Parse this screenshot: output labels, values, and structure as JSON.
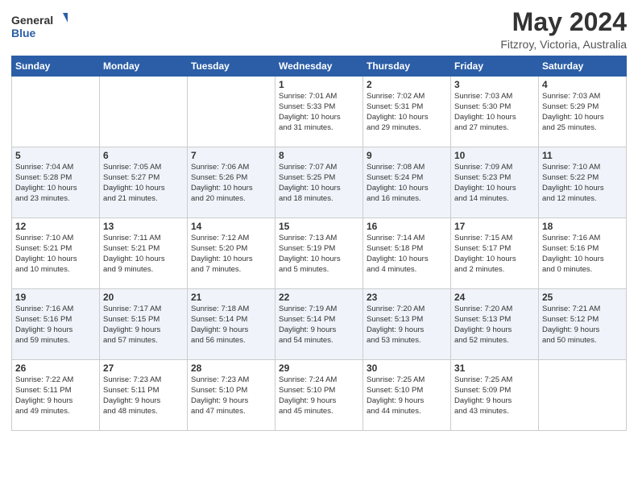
{
  "header": {
    "logo_line1": "General",
    "logo_line2": "Blue",
    "month_title": "May 2024",
    "location": "Fitzroy, Victoria, Australia"
  },
  "weekdays": [
    "Sunday",
    "Monday",
    "Tuesday",
    "Wednesday",
    "Thursday",
    "Friday",
    "Saturday"
  ],
  "weeks": [
    [
      {
        "day": "",
        "info": ""
      },
      {
        "day": "",
        "info": ""
      },
      {
        "day": "",
        "info": ""
      },
      {
        "day": "1",
        "info": "Sunrise: 7:01 AM\nSunset: 5:33 PM\nDaylight: 10 hours\nand 31 minutes."
      },
      {
        "day": "2",
        "info": "Sunrise: 7:02 AM\nSunset: 5:31 PM\nDaylight: 10 hours\nand 29 minutes."
      },
      {
        "day": "3",
        "info": "Sunrise: 7:03 AM\nSunset: 5:30 PM\nDaylight: 10 hours\nand 27 minutes."
      },
      {
        "day": "4",
        "info": "Sunrise: 7:03 AM\nSunset: 5:29 PM\nDaylight: 10 hours\nand 25 minutes."
      }
    ],
    [
      {
        "day": "5",
        "info": "Sunrise: 7:04 AM\nSunset: 5:28 PM\nDaylight: 10 hours\nand 23 minutes."
      },
      {
        "day": "6",
        "info": "Sunrise: 7:05 AM\nSunset: 5:27 PM\nDaylight: 10 hours\nand 21 minutes."
      },
      {
        "day": "7",
        "info": "Sunrise: 7:06 AM\nSunset: 5:26 PM\nDaylight: 10 hours\nand 20 minutes."
      },
      {
        "day": "8",
        "info": "Sunrise: 7:07 AM\nSunset: 5:25 PM\nDaylight: 10 hours\nand 18 minutes."
      },
      {
        "day": "9",
        "info": "Sunrise: 7:08 AM\nSunset: 5:24 PM\nDaylight: 10 hours\nand 16 minutes."
      },
      {
        "day": "10",
        "info": "Sunrise: 7:09 AM\nSunset: 5:23 PM\nDaylight: 10 hours\nand 14 minutes."
      },
      {
        "day": "11",
        "info": "Sunrise: 7:10 AM\nSunset: 5:22 PM\nDaylight: 10 hours\nand 12 minutes."
      }
    ],
    [
      {
        "day": "12",
        "info": "Sunrise: 7:10 AM\nSunset: 5:21 PM\nDaylight: 10 hours\nand 10 minutes."
      },
      {
        "day": "13",
        "info": "Sunrise: 7:11 AM\nSunset: 5:21 PM\nDaylight: 10 hours\nand 9 minutes."
      },
      {
        "day": "14",
        "info": "Sunrise: 7:12 AM\nSunset: 5:20 PM\nDaylight: 10 hours\nand 7 minutes."
      },
      {
        "day": "15",
        "info": "Sunrise: 7:13 AM\nSunset: 5:19 PM\nDaylight: 10 hours\nand 5 minutes."
      },
      {
        "day": "16",
        "info": "Sunrise: 7:14 AM\nSunset: 5:18 PM\nDaylight: 10 hours\nand 4 minutes."
      },
      {
        "day": "17",
        "info": "Sunrise: 7:15 AM\nSunset: 5:17 PM\nDaylight: 10 hours\nand 2 minutes."
      },
      {
        "day": "18",
        "info": "Sunrise: 7:16 AM\nSunset: 5:16 PM\nDaylight: 10 hours\nand 0 minutes."
      }
    ],
    [
      {
        "day": "19",
        "info": "Sunrise: 7:16 AM\nSunset: 5:16 PM\nDaylight: 9 hours\nand 59 minutes."
      },
      {
        "day": "20",
        "info": "Sunrise: 7:17 AM\nSunset: 5:15 PM\nDaylight: 9 hours\nand 57 minutes."
      },
      {
        "day": "21",
        "info": "Sunrise: 7:18 AM\nSunset: 5:14 PM\nDaylight: 9 hours\nand 56 minutes."
      },
      {
        "day": "22",
        "info": "Sunrise: 7:19 AM\nSunset: 5:14 PM\nDaylight: 9 hours\nand 54 minutes."
      },
      {
        "day": "23",
        "info": "Sunrise: 7:20 AM\nSunset: 5:13 PM\nDaylight: 9 hours\nand 53 minutes."
      },
      {
        "day": "24",
        "info": "Sunrise: 7:20 AM\nSunset: 5:13 PM\nDaylight: 9 hours\nand 52 minutes."
      },
      {
        "day": "25",
        "info": "Sunrise: 7:21 AM\nSunset: 5:12 PM\nDaylight: 9 hours\nand 50 minutes."
      }
    ],
    [
      {
        "day": "26",
        "info": "Sunrise: 7:22 AM\nSunset: 5:11 PM\nDaylight: 9 hours\nand 49 minutes."
      },
      {
        "day": "27",
        "info": "Sunrise: 7:23 AM\nSunset: 5:11 PM\nDaylight: 9 hours\nand 48 minutes."
      },
      {
        "day": "28",
        "info": "Sunrise: 7:23 AM\nSunset: 5:10 PM\nDaylight: 9 hours\nand 47 minutes."
      },
      {
        "day": "29",
        "info": "Sunrise: 7:24 AM\nSunset: 5:10 PM\nDaylight: 9 hours\nand 45 minutes."
      },
      {
        "day": "30",
        "info": "Sunrise: 7:25 AM\nSunset: 5:10 PM\nDaylight: 9 hours\nand 44 minutes."
      },
      {
        "day": "31",
        "info": "Sunrise: 7:25 AM\nSunset: 5:09 PM\nDaylight: 9 hours\nand 43 minutes."
      },
      {
        "day": "",
        "info": ""
      }
    ]
  ]
}
